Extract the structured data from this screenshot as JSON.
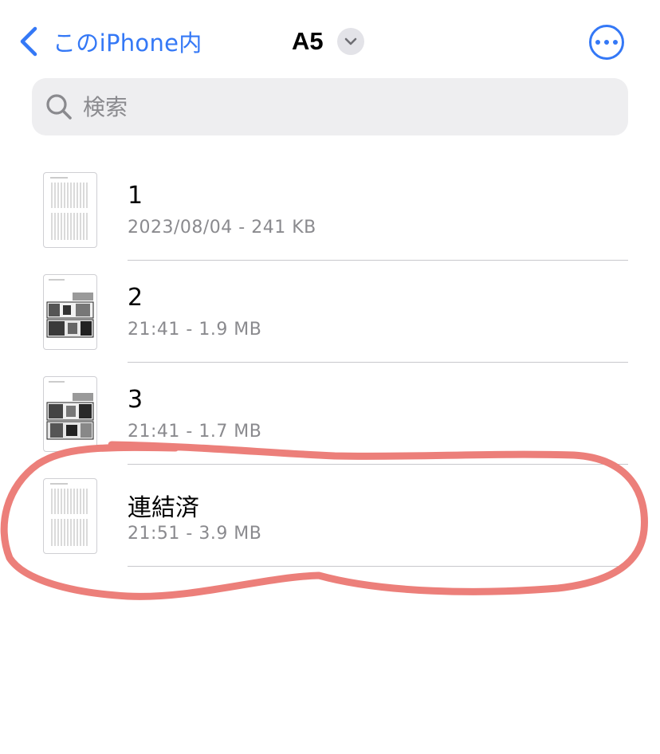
{
  "nav": {
    "back_label": "このiPhone内",
    "title": "A5"
  },
  "search": {
    "placeholder": "検索",
    "value": ""
  },
  "files": [
    {
      "name": "1",
      "meta": "2023/08/04 - 241 KB",
      "thumbnail": "text-page"
    },
    {
      "name": "2",
      "meta": "21:41 - 1.9 MB",
      "thumbnail": "manga-page"
    },
    {
      "name": "3",
      "meta": "21:41 - 1.7 MB",
      "thumbnail": "manga-page"
    },
    {
      "name": "連結済",
      "meta": "21:51 - 3.9 MB",
      "thumbnail": "text-page"
    }
  ],
  "colors": {
    "accent": "#3478f6",
    "secondary_text": "#8a8a8e",
    "search_background": "#eeeef0",
    "annotation_stroke": "#ec7f7a"
  },
  "icons": [
    "chevron-left-icon",
    "chevron-down-icon",
    "more-icon",
    "search-icon",
    "document-thumbnail"
  ]
}
